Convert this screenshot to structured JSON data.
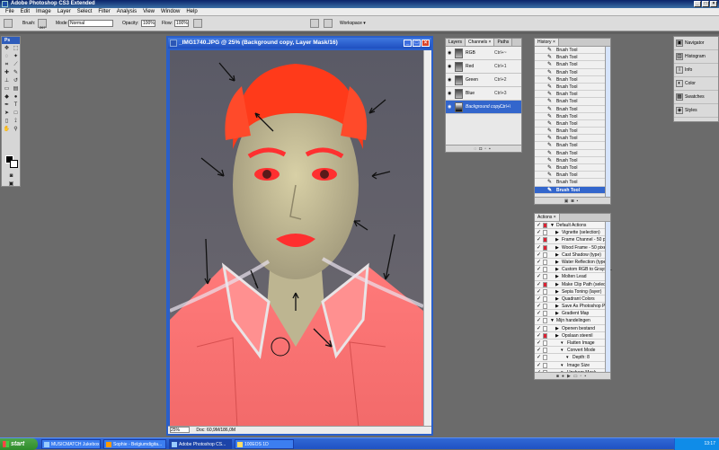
{
  "app": {
    "title": "Adobe Photoshop CS3 Extended"
  },
  "menu": [
    "File",
    "Edit",
    "Image",
    "Layer",
    "Select",
    "Filter",
    "Analysis",
    "View",
    "Window",
    "Help"
  ],
  "options": {
    "brush_label": "Brush:",
    "brush_size": "267",
    "mode_label": "Mode:",
    "mode_value": "Normal",
    "opacity_label": "Opacity:",
    "opacity_value": "100%",
    "flow_label": "Flow:",
    "flow_value": "100%",
    "workspace_label": "Workspace ▾"
  },
  "toolbox": {
    "header": "Ps"
  },
  "document": {
    "title": "_IMG1740.JPG @ 25% (Background copy, Layer Mask/16)",
    "zoom": "25%",
    "doc_info": "Doc: 60,9M/186,0M"
  },
  "channels_panel": {
    "tabs": [
      "Layers",
      "Channels ×",
      "Paths"
    ],
    "rows": [
      {
        "name": "RGB",
        "shortcut": "Ctrl+~"
      },
      {
        "name": "Red",
        "shortcut": "Ctrl+1"
      },
      {
        "name": "Green",
        "shortcut": "Ctrl+2"
      },
      {
        "name": "Blue",
        "shortcut": "Ctrl+3"
      },
      {
        "name": "Background copy...",
        "shortcut": "Ctrl+\\"
      }
    ]
  },
  "history_panel": {
    "tab": "History ×",
    "rows": [
      "Brush Tool",
      "Brush Tool",
      "Brush Tool",
      "Brush Tool",
      "Brush Tool",
      "Brush Tool",
      "Brush Tool",
      "Brush Tool",
      "Brush Tool",
      "Brush Tool",
      "Brush Tool",
      "Brush Tool",
      "Brush Tool",
      "Brush Tool",
      "Brush Tool",
      "Brush Tool",
      "Brush Tool",
      "Brush Tool",
      "Brush Tool",
      "Brush Tool"
    ]
  },
  "actions_panel": {
    "tab": "Actions ×",
    "rows": [
      {
        "label": "Default Actions",
        "indent": 0,
        "red": true
      },
      {
        "label": "Vignette (selection)",
        "indent": 1,
        "red": false
      },
      {
        "label": "Frame Channel - 50 p...",
        "indent": 1,
        "red": true
      },
      {
        "label": "Wood Frame - 50 pixel",
        "indent": 1,
        "red": true
      },
      {
        "label": "Cast Shadow (type)",
        "indent": 1,
        "red": false
      },
      {
        "label": "Water Reflection (type)",
        "indent": 1,
        "red": false
      },
      {
        "label": "Custom RGB to Graysc...",
        "indent": 1,
        "red": false
      },
      {
        "label": "Molten Lead",
        "indent": 1,
        "red": false
      },
      {
        "label": "Make Clip Path (select...",
        "indent": 1,
        "red": true
      },
      {
        "label": "Sepia Toning (layer)",
        "indent": 1,
        "red": false
      },
      {
        "label": "Quadrant Colors",
        "indent": 1,
        "red": false
      },
      {
        "label": "Save As Photoshop P...",
        "indent": 1,
        "red": false
      },
      {
        "label": "Gradient Map",
        "indent": 1,
        "red": false
      },
      {
        "label": "Mijn handelingen",
        "indent": 0,
        "red": false
      },
      {
        "label": "Openen bestand",
        "indent": 1,
        "red": false
      },
      {
        "label": "Opslaan steenil",
        "indent": 1,
        "red": true
      },
      {
        "label": "Flatten Image",
        "indent": 2,
        "red": false
      },
      {
        "label": "Convert Mode",
        "indent": 2,
        "red": false
      },
      {
        "label": "Depth: 8",
        "indent": 3,
        "red": false
      },
      {
        "label": "Image Size",
        "indent": 2,
        "red": false
      },
      {
        "label": "Unsharp Mask",
        "indent": 2,
        "red": false
      }
    ]
  },
  "right_dock": [
    "Navigator",
    "Histogram",
    "Info",
    "Color",
    "Swatches",
    "Styles"
  ],
  "taskbar": {
    "start": "start",
    "tasks": [
      "MUSICMATCH Jukebox",
      "Sophie - Belgiumdigita...",
      "Adobe Photoshop CS...",
      "100EOS 1D"
    ],
    "clock": "13:17"
  },
  "colors": {
    "accent": "#2a5fc9",
    "mask_overlay": "#ff3b3b"
  }
}
